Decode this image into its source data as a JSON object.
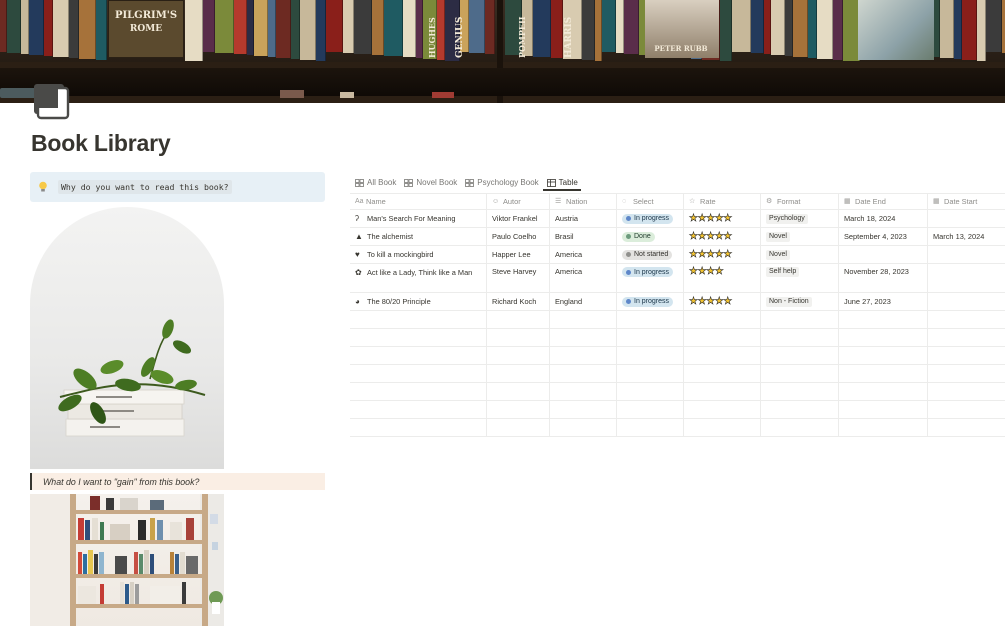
{
  "page": {
    "title": "Book Library",
    "icon": "page-icon",
    "cover": {
      "description_icon": "bookshelf-cover",
      "spine_texts": [
        "PILGRIM'S",
        "ROME",
        "GENIUS",
        "HARRIS",
        "PETER RUBB",
        "POMPEII",
        "HUGHES"
      ]
    }
  },
  "left": {
    "callout": {
      "icon": "lightbulb-icon",
      "text": "Why do you want to read this book?"
    },
    "quote": {
      "text": "What do I want to \"gain\" from this book?"
    }
  },
  "database": {
    "tabs": [
      {
        "label": "All Book",
        "icon": "gallery-icon",
        "active": false
      },
      {
        "label": "Novel Book",
        "icon": "gallery-icon",
        "active": false
      },
      {
        "label": "Psychology Book",
        "icon": "gallery-icon",
        "active": false
      },
      {
        "label": "Table",
        "icon": "table-icon",
        "active": true
      }
    ],
    "columns": [
      {
        "label": "Name",
        "icon": "text-icon"
      },
      {
        "label": "Autor",
        "icon": "person-icon"
      },
      {
        "label": "Nation",
        "icon": "list-icon"
      },
      {
        "label": "Select",
        "icon": "status-icon"
      },
      {
        "label": "Rate",
        "icon": "star-icon"
      },
      {
        "label": "Format",
        "icon": "multiselect-icon"
      },
      {
        "label": "Date End",
        "icon": "calendar-icon"
      },
      {
        "label": "Date Start",
        "icon": "calendar-icon"
      }
    ],
    "rows": [
      {
        "icon": "brain-icon",
        "icon_glyph": "ʔ",
        "name": "Man's Search For Meaning",
        "autor": "Viktor Frankel",
        "nation": "Austria",
        "status": "In progress",
        "status_kind": "progress",
        "rate": "★★★★★",
        "format": "Psychology",
        "date_end": "March 18, 2024",
        "date_start": ""
      },
      {
        "icon": "mountain-icon",
        "icon_glyph": "▲",
        "name": "The alchemist",
        "autor": "Paulo Coelho",
        "nation": "Brasil",
        "status": "Done",
        "status_kind": "done",
        "rate": "★★★★★",
        "format": "Novel",
        "date_end": "September 4, 2023",
        "date_start": "March 13, 2024"
      },
      {
        "icon": "heart-icon",
        "icon_glyph": "♥",
        "name": "To kill a mockingbird",
        "autor": "Happer Lee",
        "nation": "America",
        "status": "Not started",
        "status_kind": "not",
        "rate": "★★★★★",
        "format": "Novel",
        "date_end": "",
        "date_start": ""
      },
      {
        "icon": "gear-icon",
        "icon_glyph": "✿",
        "name": "Act like a Lady, Think like a Man",
        "autor": "Steve Harvey",
        "nation": "America",
        "status": "In progress",
        "status_kind": "progress",
        "rate": "★★★★",
        "format": "Self help",
        "date_end": "November 28, 2023",
        "date_start": ""
      },
      {
        "icon": "globe-icon",
        "icon_glyph": "◕",
        "name": "The 80/20 Principle",
        "autor": "Richard Koch",
        "nation": "England",
        "status": "In progress",
        "status_kind": "progress",
        "rate": "★★★★★",
        "format": "Non - Fiction",
        "date_end": "June 27, 2023",
        "date_start": ""
      }
    ],
    "empty_rows": 7
  },
  "colors": {
    "text": "#37352f",
    "callout_bg": "#e7f0f6",
    "quote_bg": "#faeee4",
    "in_progress": "#d3e5ef",
    "done": "#dbeddb",
    "not_started": "#e3e2e0",
    "star": "#f4c430"
  }
}
